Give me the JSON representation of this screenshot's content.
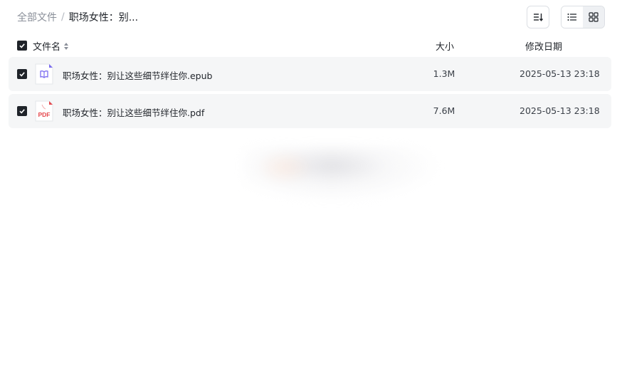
{
  "breadcrumb": {
    "root": "全部文件",
    "separator": "/",
    "current": "职场女性：别..."
  },
  "toolbar": {
    "sort_icon": "sort-icon",
    "list_view_icon": "list-view-icon",
    "grid_view_icon": "grid-view-icon",
    "active_view": "list"
  },
  "table": {
    "columns": {
      "name": "文件名",
      "size": "大小",
      "date": "修改日期"
    },
    "rows": [
      {
        "name": "职场女性：别让这些细节绊住你.epub",
        "size": "1.3M",
        "date": "2025-05-13 23:18",
        "type": "epub",
        "icon": "epub-file-icon"
      },
      {
        "name": "职场女性：别让这些细节绊住你.pdf",
        "size": "7.6M",
        "date": "2025-05-13 23:18",
        "type": "pdf",
        "icon": "pdf-file-icon",
        "icon_text": "PDF"
      }
    ]
  },
  "colors": {
    "checkbox": "#1f2329",
    "row_bg": "#f5f6f7",
    "pdf_red": "#e5484d",
    "epub_purple": "#7b6cf0"
  }
}
